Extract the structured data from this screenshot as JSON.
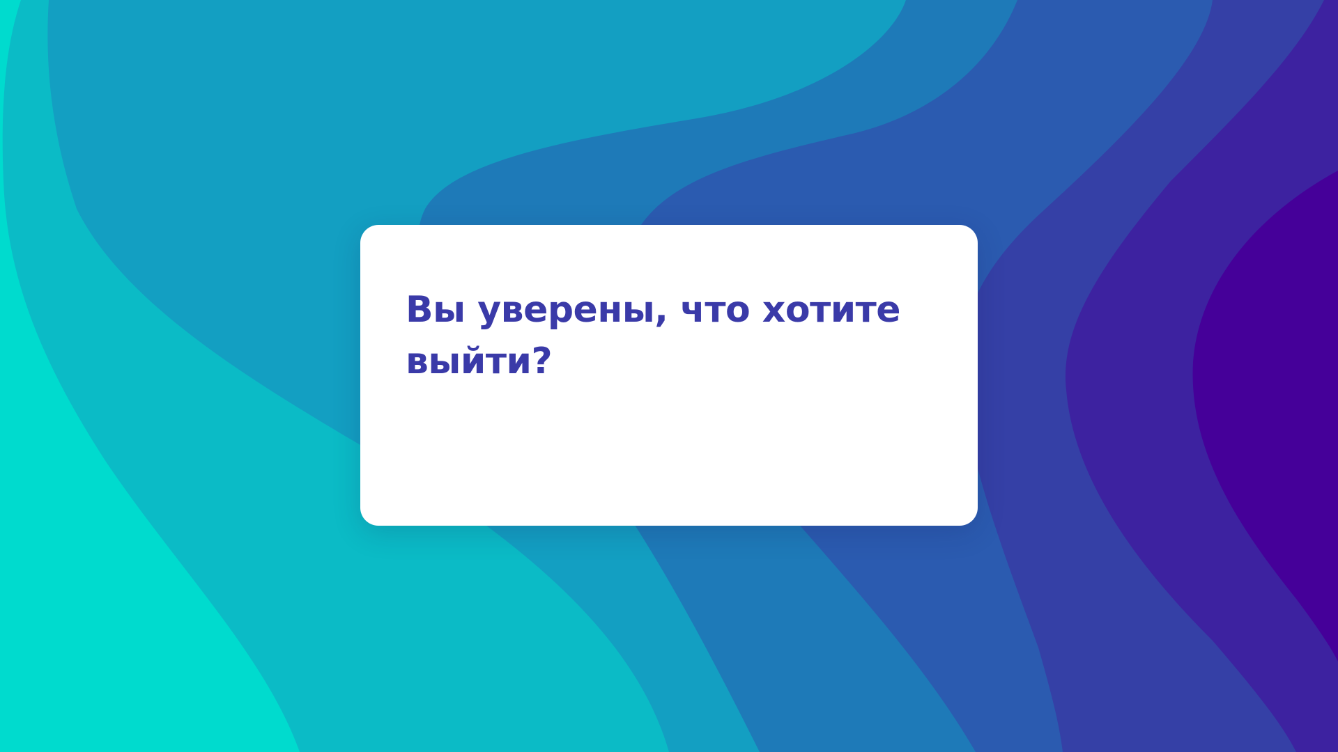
{
  "dialog": {
    "title": "Вы уверены, что хотите выйти?"
  },
  "background": {
    "layer_colors": [
      "#00dbce",
      "#0bbbc6",
      "#139fc2",
      "#1e7ab8",
      "#2b5bb0",
      "#3540a6",
      "#3d22a0",
      "#450099"
    ]
  },
  "colors": {
    "dialog_background": "#ffffff",
    "title_text": "#3a3aa8"
  }
}
